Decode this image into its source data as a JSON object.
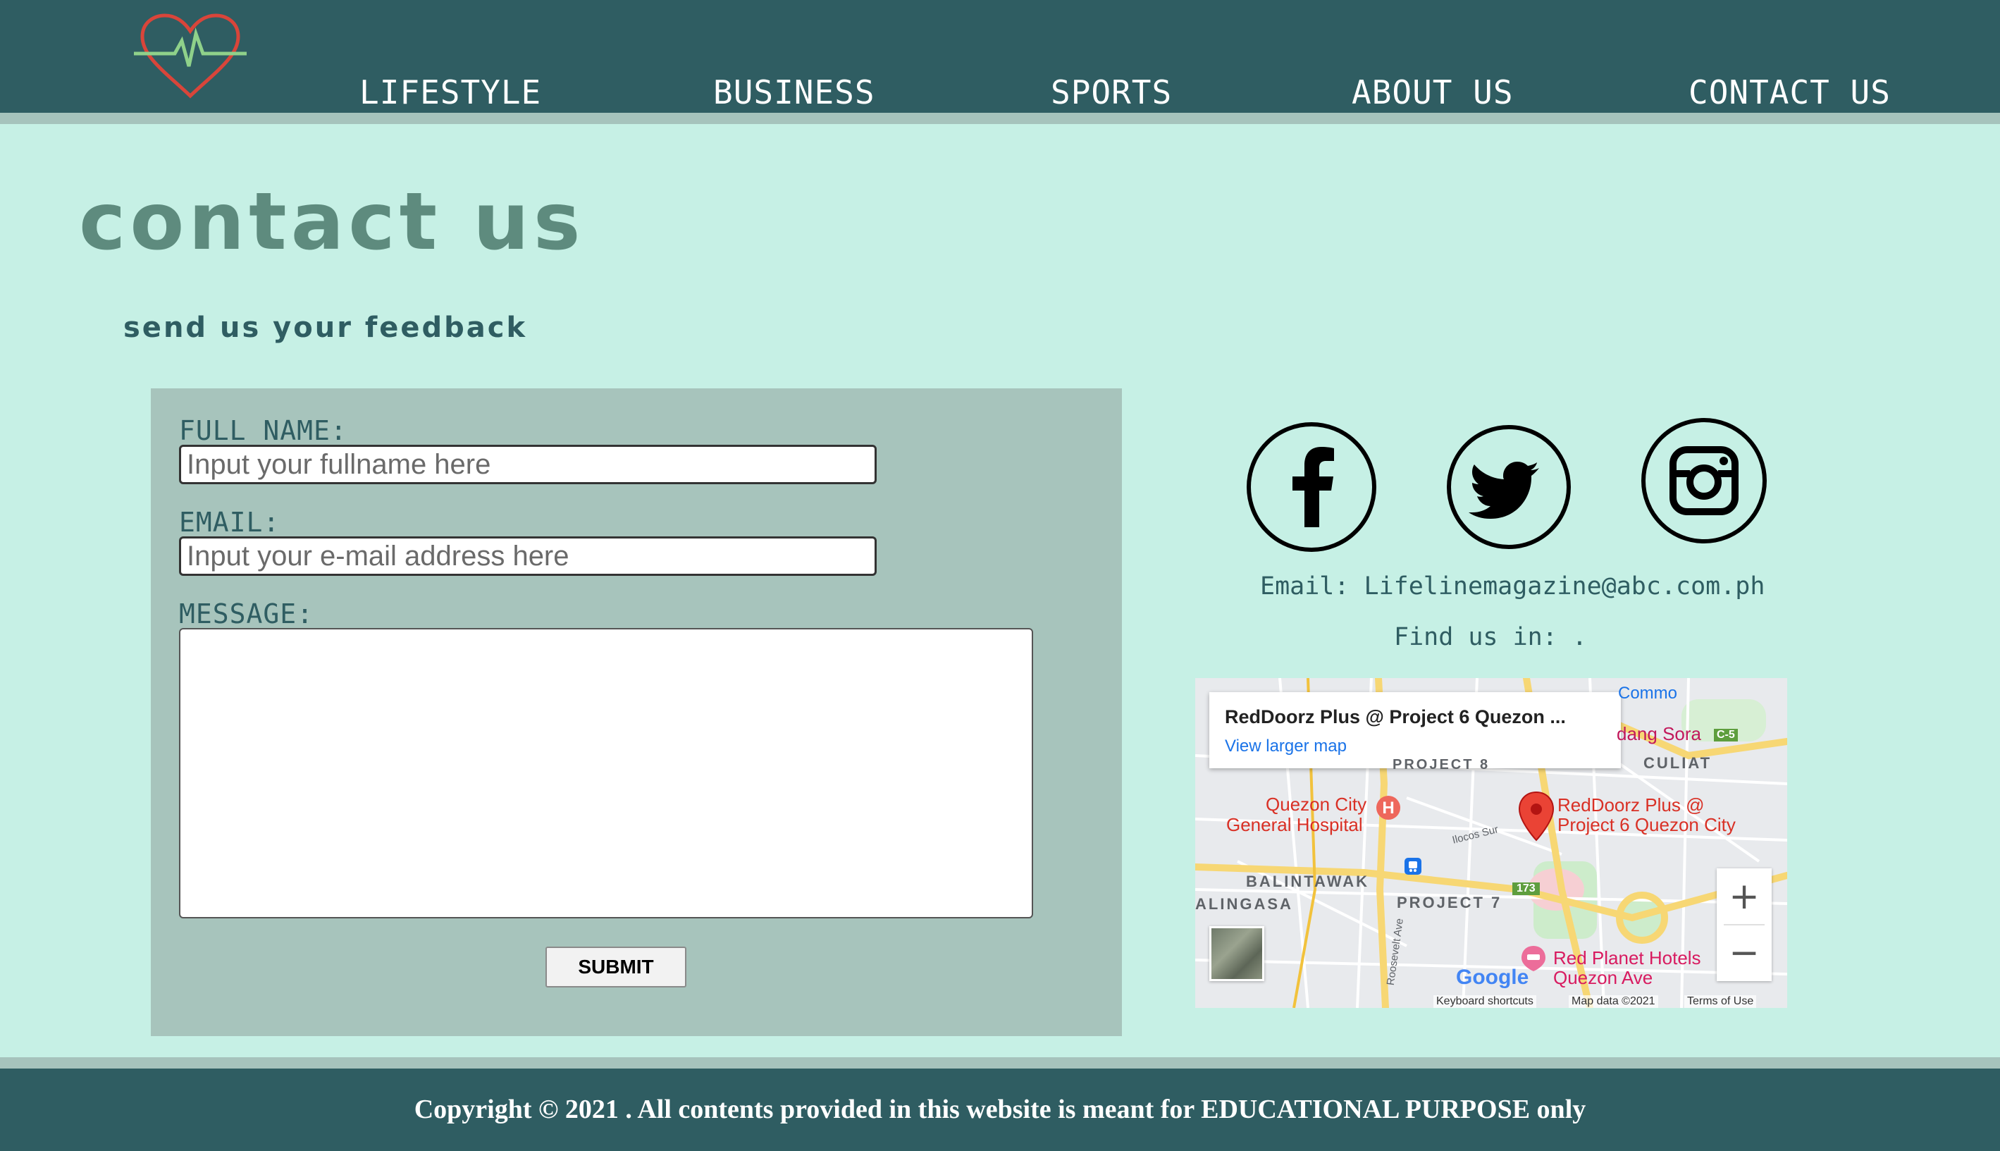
{
  "nav": {
    "items": [
      {
        "label": "LIFESTYLE"
      },
      {
        "label": "BUSINESS"
      },
      {
        "label": "SPORTS"
      },
      {
        "label": "ABOUT US"
      },
      {
        "label": "CONTACT US"
      }
    ]
  },
  "page": {
    "title": "contact us",
    "subtitle": "send us your feedback"
  },
  "form": {
    "full_name_label": "FULL NAME:",
    "full_name_placeholder": "Input your fullname here",
    "email_label": "EMAIL:",
    "email_placeholder": "Input your e-mail address here",
    "message_label": "MESSAGE:",
    "submit_label": "SUBMIT"
  },
  "contact": {
    "email_text": "Email: Lifelinemagazine@abc.com.ph",
    "find_us_text": "Find us in: ."
  },
  "map": {
    "card_title": "RedDoorz Plus @ Project 6 Quezon ...",
    "card_link": "View larger map",
    "labels": {
      "hospital": [
        "Quezon City",
        "General Hospital"
      ],
      "reddoorz": [
        "RedDoorz Plus @",
        "Project 6 Quezon City"
      ],
      "red_planet": [
        "Red Planet Hotels",
        "Quezon Ave"
      ],
      "balintawak": "BALINTAWAK",
      "balingasa": "ALINGASA",
      "project7": "PROJECT 7",
      "project8": "PROJECT 8",
      "culiat": "CULIAT",
      "tandang_sora": "dang Sora",
      "commonwealth": "Commo",
      "c5": "C-5",
      "route173": "173",
      "google": "Google",
      "keyboard": "Keyboard shortcuts",
      "map_data": "Map data ©2021",
      "terms": "Terms of Use",
      "roosevelt": "Roosevelt Ave",
      "ilocos": "Ilocos Sur"
    },
    "zoom_in": "+",
    "zoom_out": "−"
  },
  "social": {
    "icons": [
      "facebook-icon",
      "twitter-icon",
      "instagram-icon"
    ]
  },
  "footer": {
    "copyright": "Copyright © 2021 . All contents provided in this website is meant for EDUCATIONAL PURPOSE only"
  },
  "colors": {
    "header_bg": "#2f5d62",
    "page_bg": "#c6f0e5",
    "panel_bg": "#a7c4bc",
    "title": "#5e8b7e",
    "accent_text": "#2f5d62",
    "map_pin": "#ea4335"
  }
}
